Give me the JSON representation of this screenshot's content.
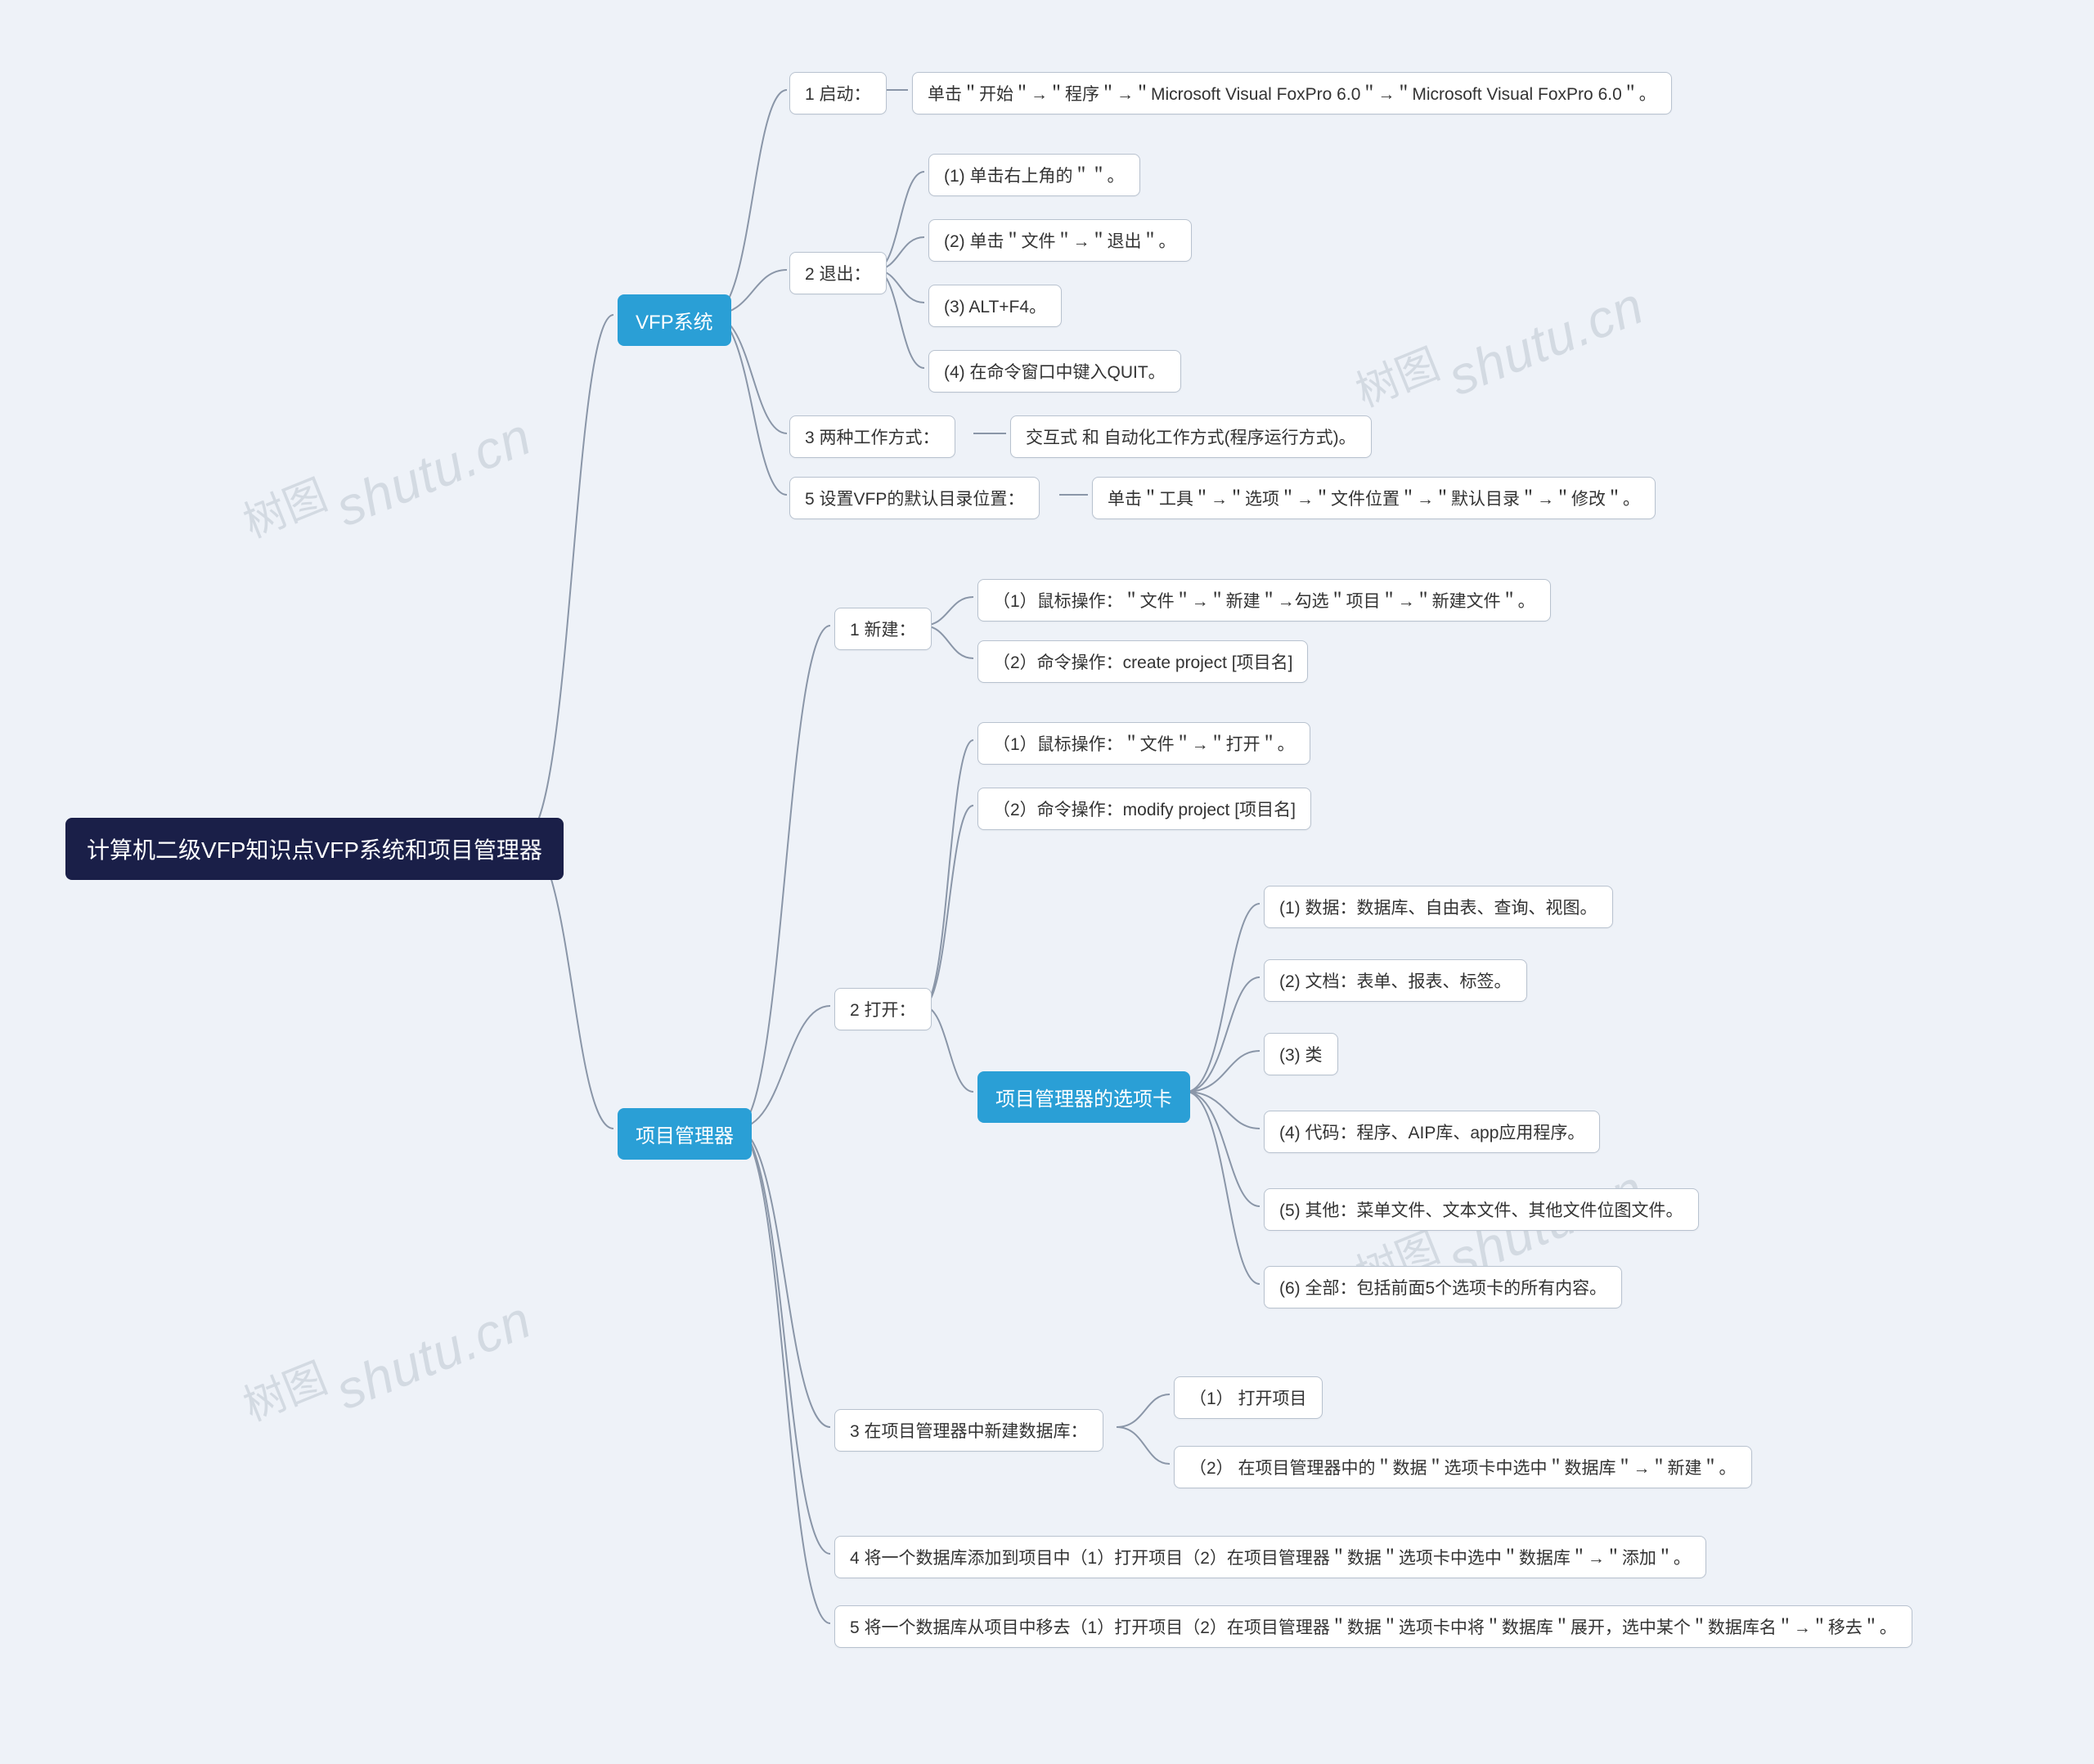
{
  "watermark": {
    "cn": "树图",
    "en": "shutu.cn"
  },
  "root": {
    "label": "计算机二级VFP知识点VFP系统和项目管理器"
  },
  "vfp": {
    "label": "VFP系统",
    "n1": {
      "label": "1 启动：",
      "leaf": "单击＂开始＂→＂程序＂→＂Microsoft Visual FoxPro 6.0＂→＂Microsoft Visual FoxPro 6.0＂。"
    },
    "n2": {
      "label": "2 退出：",
      "a": "(1) 单击右上角的＂＂。",
      "b": "(2) 单击＂文件＂→＂退出＂。",
      "c": "(3) ALT+F4。",
      "d": "(4) 在命令窗口中键入QUIT。"
    },
    "n3": {
      "label": "3 两种工作方式：",
      "leaf": "交互式 和 自动化工作方式(程序运行方式)。"
    },
    "n5": {
      "label": "5 设置VFP的默认目录位置：",
      "leaf": "单击＂工具＂→＂选项＂→＂文件位置＂→＂默认目录＂→＂修改＂。"
    }
  },
  "pm": {
    "label": "项目管理器",
    "n1": {
      "label": "1 新建：",
      "a": "（1）鼠标操作：＂文件＂→＂新建＂→勾选＂项目＂→＂新建文件＂。",
      "b": "（2）命令操作：create project [项目名]"
    },
    "n2": {
      "label": "2 打开：",
      "a": "（1）鼠标操作：＂文件＂→＂打开＂。",
      "b": "（2）命令操作：modify project [项目名]",
      "tabs": {
        "label": "项目管理器的选项卡",
        "t1": "(1) 数据：数据库、自由表、查询、视图。",
        "t2": "(2) 文档：表单、报表、标签。",
        "t3": "(3) 类",
        "t4": "(4) 代码：程序、AIP库、app应用程序。",
        "t5": "(5) 其他：菜单文件、文本文件、其他文件位图文件。",
        "t6": "(6) 全部：包括前面5个选项卡的所有内容。"
      }
    },
    "n3": {
      "label": "3 在项目管理器中新建数据库：",
      "a": "（1） 打开项目",
      "b": "（2） 在项目管理器中的＂数据＂选项卡中选中＂数据库＂→＂新建＂。"
    },
    "n4": "4 将一个数据库添加到项目中（1）打开项目（2）在项目管理器＂数据＂选项卡中选中＂数据库＂→＂添加＂。",
    "n5": "5 将一个数据库从项目中移去（1）打开项目（2）在项目管理器＂数据＂选项卡中将＂数据库＂展开，选中某个＂数据库名＂→＂移去＂。"
  }
}
